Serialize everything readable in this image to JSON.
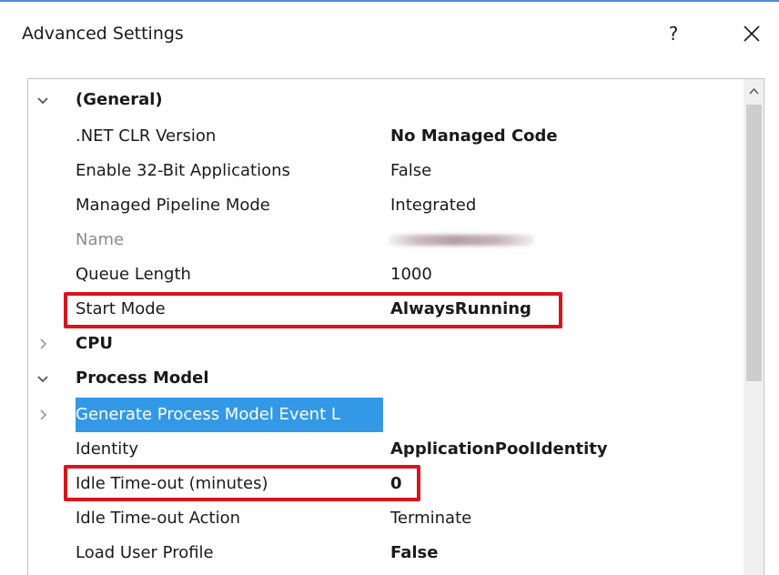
{
  "window": {
    "title": "Advanced Settings",
    "help_label": "?",
    "close_icon": "close-icon"
  },
  "categories": {
    "general": "(General)",
    "cpu": "CPU",
    "process_model": "Process Model"
  },
  "properties": {
    "net_clr_version": {
      "label": ".NET CLR Version",
      "value": "No Managed Code"
    },
    "enable_32bit": {
      "label": "Enable 32-Bit Applications",
      "value": "False"
    },
    "managed_pipeline": {
      "label": "Managed Pipeline Mode",
      "value": "Integrated"
    },
    "name": {
      "label": "Name",
      "value": ""
    },
    "queue_length": {
      "label": "Queue Length",
      "value": "1000"
    },
    "start_mode": {
      "label": "Start Mode",
      "value": "AlwaysRunning"
    },
    "generate_event_log": {
      "label": "Generate Process Model Event L",
      "value": ""
    },
    "identity": {
      "label": "Identity",
      "value": "ApplicationPoolIdentity"
    },
    "idle_timeout": {
      "label": "Idle Time-out (minutes)",
      "value": "0"
    },
    "idle_timeout_action": {
      "label": "Idle Time-out Action",
      "value": "Terminate"
    },
    "load_user_profile": {
      "label": "Load User Profile",
      "value": "False"
    }
  },
  "colors": {
    "accent_top": "#4a90d9",
    "selection": "#3399e6",
    "highlight": "#d9141e"
  }
}
